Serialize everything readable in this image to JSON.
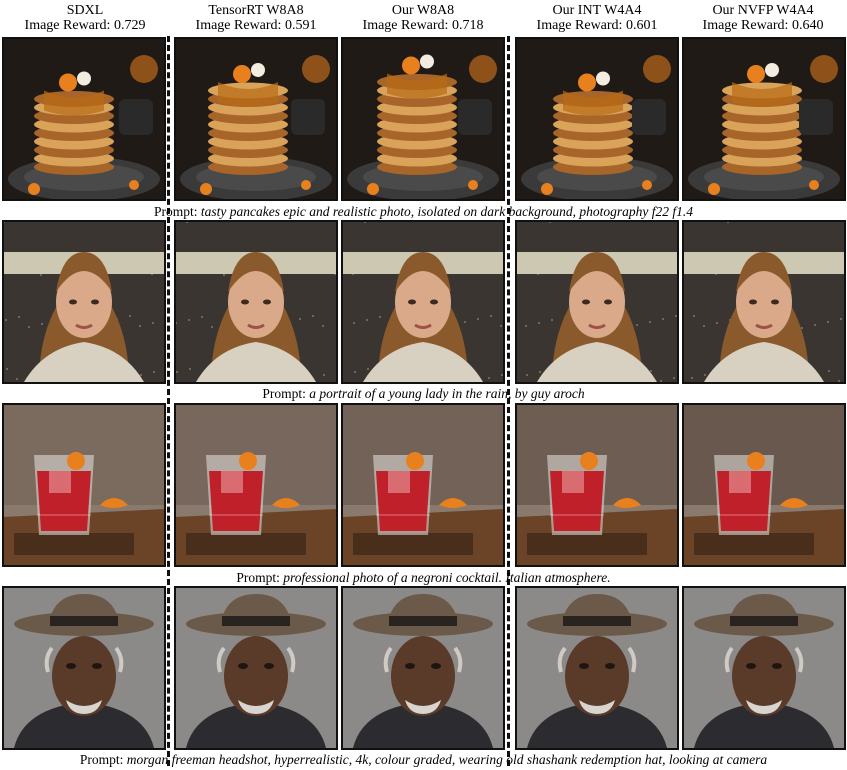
{
  "columns": [
    {
      "title": "SDXL",
      "reward": "Image Reward: 0.729"
    },
    {
      "title": "TensorRT W8A8",
      "reward": "Image Reward: 0.591"
    },
    {
      "title": "Our W8A8",
      "reward": "Image Reward: 0.718"
    },
    {
      "title": "Our INT W4A4",
      "reward": "Image Reward: 0.601"
    },
    {
      "title": "Our NVFP W4A4",
      "reward": "Image Reward: 0.640"
    }
  ],
  "prompt_label": "Prompt:",
  "rows": [
    {
      "subject": "pancakes",
      "prompt": "tasty pancakes epic and realistic photo, isolated on dark background, photography f22 f1.4"
    },
    {
      "subject": "portrait",
      "prompt": "a portrait of a young lady in the rain, by guy aroch"
    },
    {
      "subject": "cocktail",
      "prompt": "professional photo of a negroni cocktail. Italian atmosphere."
    },
    {
      "subject": "headshot",
      "prompt": "morgan freeman headshot, hyperrealistic, 4k, colour graded, wearing old shashank redemption hat, looking at camera"
    }
  ],
  "palette": {
    "pancake": "#d9a35a",
    "pancake_dark": "#a8652a",
    "syrup": "#b86a14",
    "plate": "#3a3a3a",
    "hair": "#8a5a2c",
    "skin": "#d9a98a",
    "negroni": "#c0202a",
    "orange": "#e8801e",
    "wood": "#6b4428",
    "hat": "#6b5a4a",
    "face_dark": "#5a3a28"
  }
}
